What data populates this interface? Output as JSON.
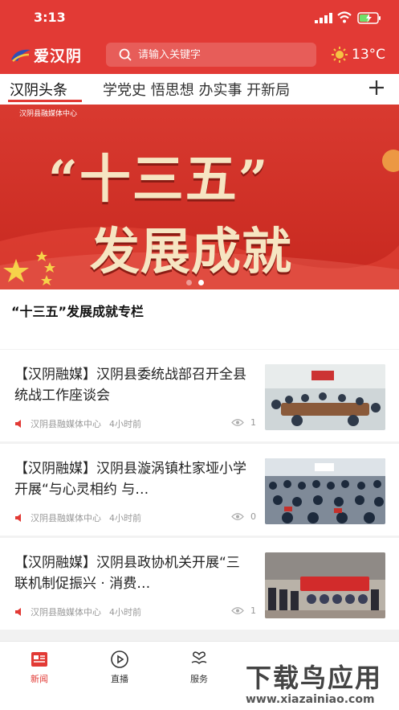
{
  "status_bar": {
    "time": "3:13"
  },
  "header": {
    "logo_text": "爱汉阴",
    "search_placeholder": "请输入关键字",
    "temperature": "13°C"
  },
  "tabs": [
    {
      "label": "汉阴头条",
      "active": true
    },
    {
      "label": "学党史 悟思想 办实事 开新局",
      "active": false
    }
  ],
  "banner": {
    "source": "汉阴县融媒体中心",
    "line1": "“十三五”",
    "line2": "发展成就",
    "caption": "“十三五”发展成就专栏"
  },
  "news": [
    {
      "title": "【汉阴融媒】汉阴县委统战部召开全县统战工作座谈会",
      "source": "汉阴县融媒体中心",
      "time": "4小时前",
      "views": "1"
    },
    {
      "title": "【汉阴融媒】汉阴县漩涡镇杜家垭小学开展“与心灵相约 与…",
      "source": "汉阴县融媒体中心",
      "time": "4小时前",
      "views": "0"
    },
    {
      "title": "【汉阴融媒】汉阴县政协机关开展“三联机制促振兴 · 消费…",
      "source": "汉阴县融媒体中心",
      "time": "4小时前",
      "views": "1"
    }
  ],
  "bottom_nav": [
    {
      "label": "新闻",
      "icon": "news-icon",
      "active": true
    },
    {
      "label": "直播",
      "icon": "play-icon",
      "active": false
    },
    {
      "label": "服务",
      "icon": "heart-hand-icon",
      "active": false
    }
  ],
  "watermark": {
    "line1": "下载鸟应用",
    "line2": "www.xiazainiao.com"
  },
  "colors": {
    "accent": "#e23a35"
  }
}
